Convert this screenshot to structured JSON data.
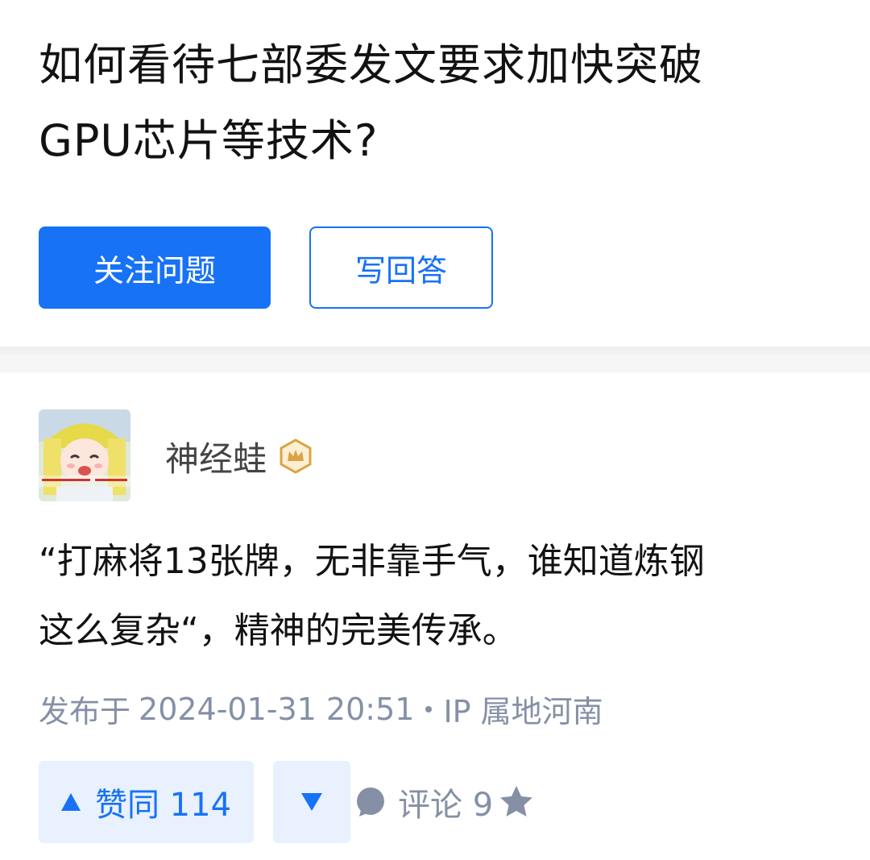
{
  "question": {
    "title_line1": "如何看待七部委发文要求加快突破",
    "title_line2": "GPU芯片等技术?",
    "follow_label": "关注问题",
    "answer_label": "写回答"
  },
  "answer": {
    "author_name": "神经蛙",
    "badge_icon": "crown-badge-icon",
    "content_line1": "“打麻将13张牌，无非靠手气，谁知道炼钢",
    "content_line2": "这么复杂“，精神的完美传承。",
    "meta": {
      "published_prefix": "发布于",
      "timestamp": "2024-01-31 20:51",
      "ip_label": "IP 属地河南"
    },
    "actions": {
      "upvote_label": "赞同 114",
      "comment_label": "评论 9"
    }
  },
  "colors": {
    "accent": "#1772f6",
    "meta_text": "#8590a6",
    "vote_bg": "#e8f1fd",
    "badge_gold": "#d9a441"
  }
}
